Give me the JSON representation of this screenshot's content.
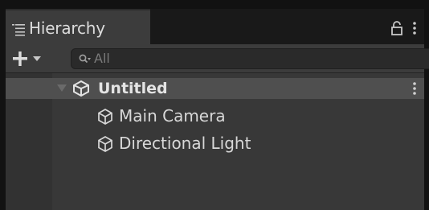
{
  "window": {
    "tab_label": "Hierarchy",
    "tab_icon": "list-icon",
    "lock_icon": "lock-icon",
    "menu_icon": "kebab-menu-icon"
  },
  "toolbar": {
    "add_icon": "plus-icon",
    "dropdown_icon": "chevron-down-icon",
    "search_placeholder": "All",
    "search_icon": "search-icon"
  },
  "hierarchy": {
    "scene": {
      "name": "Untitled",
      "expanded": true,
      "icon": "unity-scene-icon"
    },
    "items": [
      {
        "name": "Main Camera",
        "icon": "gameobject-cube-icon"
      },
      {
        "name": "Directional Light",
        "icon": "gameobject-cube-icon"
      }
    ]
  },
  "colors": {
    "panel_bg": "#383838",
    "selected_row": "#4f4f4f",
    "text": "#d8d8d8"
  }
}
